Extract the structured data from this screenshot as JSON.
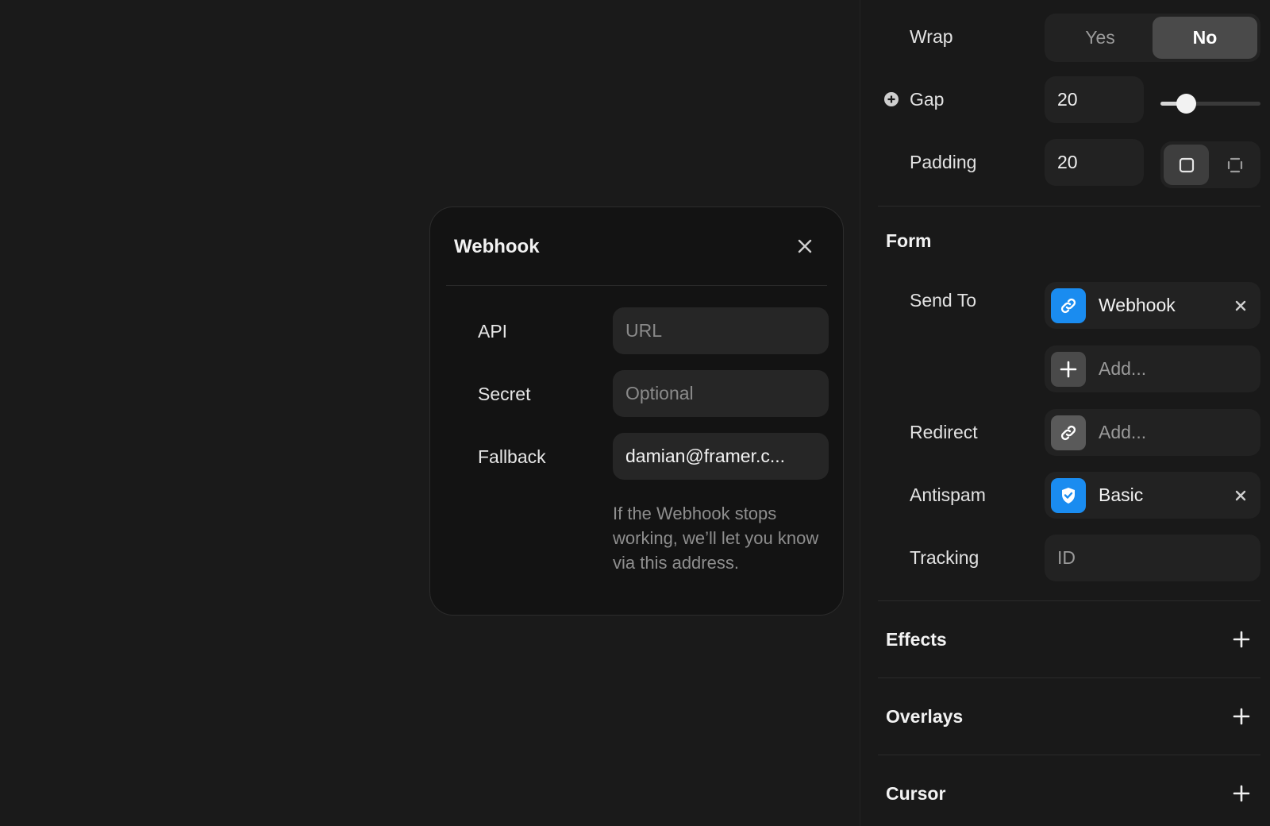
{
  "modal": {
    "title": "Webhook",
    "fields": {
      "api": {
        "label": "API",
        "placeholder": "URL",
        "value": ""
      },
      "secret": {
        "label": "Secret",
        "placeholder": "Optional",
        "value": ""
      },
      "fallback": {
        "label": "Fallback",
        "value": "damian@framer.c..."
      }
    },
    "helper_text": "If the Webhook stops working, we’ll let you know via this address."
  },
  "panel": {
    "wrap": {
      "label": "Wrap",
      "options": [
        "Yes",
        "No"
      ],
      "selected": "No"
    },
    "gap": {
      "label": "Gap",
      "value": "20",
      "slider_fraction": 0.25
    },
    "padding": {
      "label": "Padding",
      "value": "20"
    },
    "form": {
      "title": "Form",
      "send_to": {
        "label": "Send To",
        "value": "Webhook",
        "add_placeholder": "Add..."
      },
      "redirect": {
        "label": "Redirect",
        "placeholder": "Add..."
      },
      "antispam": {
        "label": "Antispam",
        "value": "Basic"
      },
      "tracking": {
        "label": "Tracking",
        "placeholder": "ID"
      }
    },
    "sections": [
      {
        "title": "Effects"
      },
      {
        "title": "Overlays"
      },
      {
        "title": "Cursor"
      }
    ]
  },
  "colors": {
    "background": "#1a1a1a",
    "modal_bg": "#131313",
    "field_bg": "#262626",
    "accent_blue": "#1a8cf0",
    "segment_active": "#4a4a4a"
  },
  "icons": [
    "close-icon",
    "link-icon",
    "plus-icon",
    "shield-check-icon",
    "plus-circle-icon",
    "padding-uniform-icon",
    "padding-individual-icon"
  ]
}
